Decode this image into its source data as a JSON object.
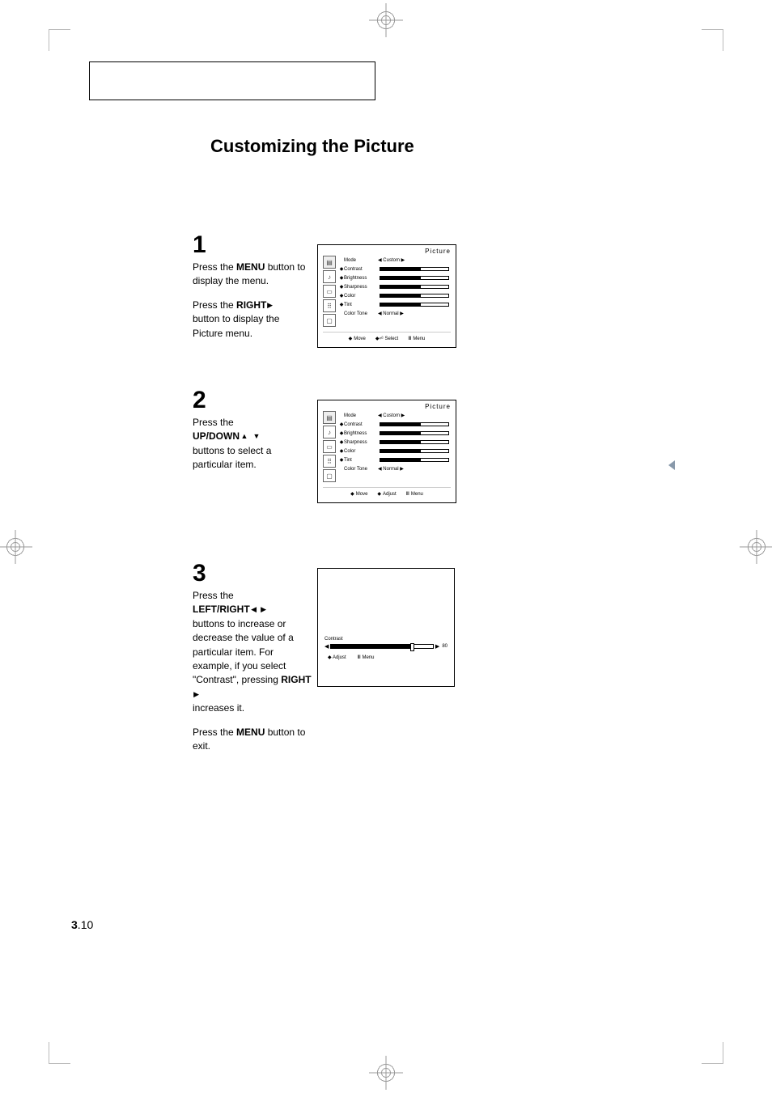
{
  "title": "Customizing the Picture",
  "steps": [
    {
      "number": "1",
      "line1a": "Press the ",
      "bold1": "MENU",
      "line1b": " button to display the menu.",
      "line2a": "Press the ",
      "bold2": "RIGHT",
      "line2b": "button to display the Picture menu."
    },
    {
      "number": "2",
      "line1a": "Press the",
      "bold1": "UP/DOWN",
      "line1b": "buttons to select a particular item."
    },
    {
      "number": "3",
      "line1a": "Press the",
      "bold1": "LEFT/RIGHT",
      "line1b": "buttons to increase or decrease the value of a particular item. For example, if you select \"Contrast\", pressing ",
      "bold2": "RIGHT",
      "line1c": "increases it.",
      "line2a": "Press the ",
      "bold3": "MENU",
      "line2b": " button to exit."
    }
  ],
  "osd": {
    "title": "Picture",
    "items": [
      {
        "label": "Mode",
        "value": "Custom"
      },
      {
        "label": "Contrast"
      },
      {
        "label": "Brightness"
      },
      {
        "label": "Sharpness"
      },
      {
        "label": "Color"
      },
      {
        "label": "Tint"
      },
      {
        "label": "Color Tone",
        "value": "Normal"
      }
    ],
    "footer1": {
      "move": "Move",
      "select": "Select",
      "menu": "Menu"
    },
    "footer2": {
      "move": "Move",
      "adjust": "Adjust",
      "menu": "Menu"
    }
  },
  "osd3": {
    "label": "Contrast",
    "value": "80",
    "footer": {
      "adjust": "Adjust",
      "menu": "Menu"
    }
  },
  "page": {
    "section": "3",
    "sep": ".",
    "num": "10"
  }
}
